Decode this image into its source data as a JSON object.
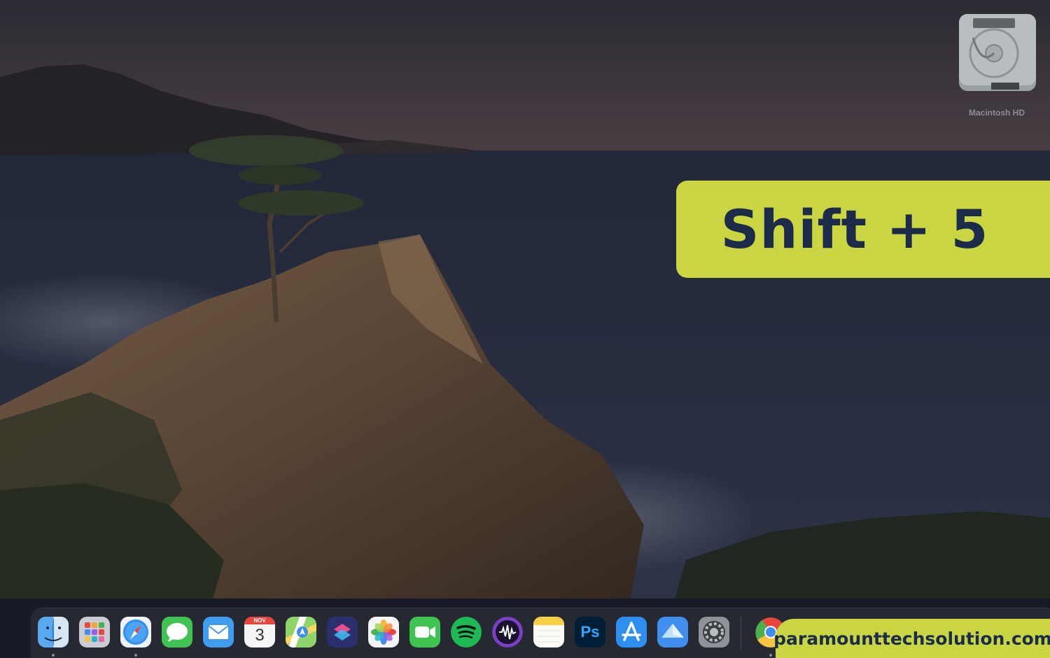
{
  "desktop": {
    "disk_label": "Macintosh HD"
  },
  "banner": {
    "shortcut": "Shift + 5",
    "color": "#c9d641",
    "text_color": "#1c2b4a"
  },
  "dock": {
    "apps": [
      {
        "name": "Finder",
        "icon": "finder-icon",
        "running": true
      },
      {
        "name": "Launchpad",
        "icon": "launchpad-icon"
      },
      {
        "name": "Safari",
        "icon": "safari-icon",
        "running": true
      },
      {
        "name": "Messages",
        "icon": "messages-icon"
      },
      {
        "name": "Mail",
        "icon": "mail-icon"
      },
      {
        "name": "Calendar",
        "icon": "calendar-icon",
        "month": "NOV",
        "day": "3"
      },
      {
        "name": "Maps",
        "icon": "maps-icon"
      },
      {
        "name": "Shortcuts",
        "icon": "shortcuts-icon"
      },
      {
        "name": "Photos",
        "icon": "photos-icon"
      },
      {
        "name": "FaceTime",
        "icon": "facetime-icon"
      },
      {
        "name": "Spotify",
        "icon": "spotify-icon"
      },
      {
        "name": "Audio app",
        "icon": "waveform-icon"
      },
      {
        "name": "Notes",
        "icon": "notes-icon"
      },
      {
        "name": "Photoshop",
        "icon": "photoshop-icon",
        "label": "Ps"
      },
      {
        "name": "App Store",
        "icon": "app-store-icon"
      },
      {
        "name": "Preview",
        "icon": "preview-icon"
      },
      {
        "name": "System Settings",
        "icon": "settings-icon"
      },
      {
        "name": "Chrome",
        "icon": "chrome-icon",
        "running": true
      }
    ]
  },
  "watermark": {
    "text": "paramounttechsolution.com"
  }
}
